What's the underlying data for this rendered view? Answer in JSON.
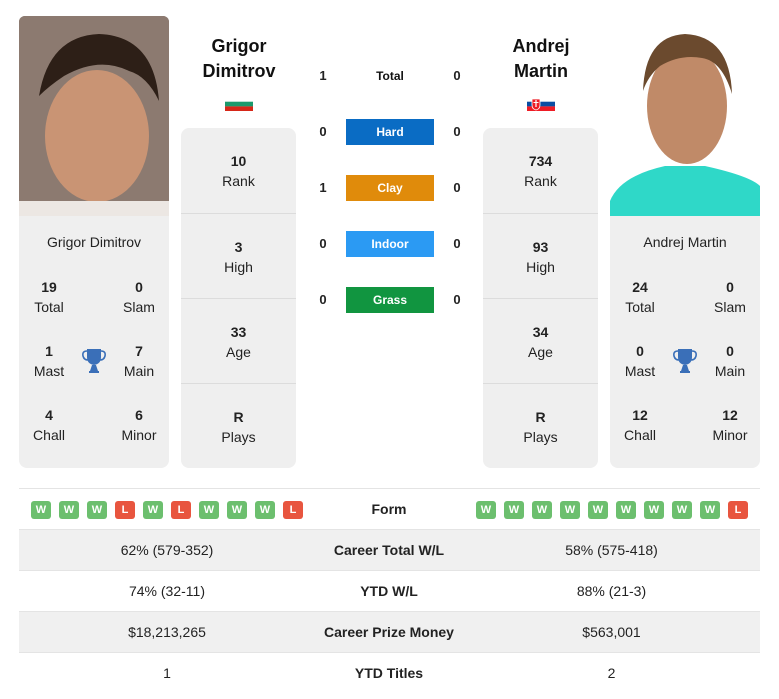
{
  "player1": {
    "name_line1": "Grigor",
    "name_line2": "Dimitrov",
    "full_name": "Grigor Dimitrov",
    "country_flag": "bulgaria-flag",
    "titles": {
      "total": {
        "value": "19",
        "label": "Total"
      },
      "slam": {
        "value": "0",
        "label": "Slam"
      },
      "mast": {
        "value": "1",
        "label": "Mast"
      },
      "main": {
        "value": "7",
        "label": "Main"
      },
      "chall": {
        "value": "4",
        "label": "Chall"
      },
      "minor": {
        "value": "6",
        "label": "Minor"
      }
    },
    "stats": [
      {
        "value": "10",
        "label": "Rank"
      },
      {
        "value": "3",
        "label": "High"
      },
      {
        "value": "33",
        "label": "Age"
      },
      {
        "value": "R",
        "label": "Plays"
      }
    ],
    "form": [
      "W",
      "W",
      "W",
      "L",
      "W",
      "L",
      "W",
      "W",
      "W",
      "L"
    ]
  },
  "player2": {
    "name_line1": "Andrej",
    "name_line2": "Martin",
    "full_name": "Andrej Martin",
    "country_flag": "slovakia-flag",
    "titles": {
      "total": {
        "value": "24",
        "label": "Total"
      },
      "slam": {
        "value": "0",
        "label": "Slam"
      },
      "mast": {
        "value": "0",
        "label": "Mast"
      },
      "main": {
        "value": "0",
        "label": "Main"
      },
      "chall": {
        "value": "12",
        "label": "Chall"
      },
      "minor": {
        "value": "12",
        "label": "Minor"
      }
    },
    "stats": [
      {
        "value": "734",
        "label": "Rank"
      },
      {
        "value": "93",
        "label": "High"
      },
      {
        "value": "34",
        "label": "Age"
      },
      {
        "value": "R",
        "label": "Plays"
      }
    ],
    "form": [
      "W",
      "W",
      "W",
      "W",
      "W",
      "W",
      "W",
      "W",
      "W",
      "L"
    ]
  },
  "h2h": [
    {
      "label": "Total",
      "p1": "1",
      "p2": "0",
      "color": ""
    },
    {
      "label": "Hard",
      "p1": "0",
      "p2": "0",
      "color": "#0a6cc4"
    },
    {
      "label": "Clay",
      "p1": "1",
      "p2": "0",
      "color": "#e08b0b"
    },
    {
      "label": "Indoor",
      "p1": "0",
      "p2": "0",
      "color": "#2b9af3"
    },
    {
      "label": "Grass",
      "p1": "0",
      "p2": "0",
      "color": "#119540"
    }
  ],
  "comparison": {
    "form_label": "Form",
    "rows": [
      {
        "label": "Career Total W/L",
        "p1": "62% (579-352)",
        "p2": "58% (575-418)"
      },
      {
        "label": "YTD W/L",
        "p1": "74% (32-11)",
        "p2": "88% (21-3)"
      },
      {
        "label": "Career Prize Money",
        "p1": "$18,213,265",
        "p2": "$563,001"
      },
      {
        "label": "YTD Titles",
        "p1": "1",
        "p2": "2"
      }
    ]
  }
}
